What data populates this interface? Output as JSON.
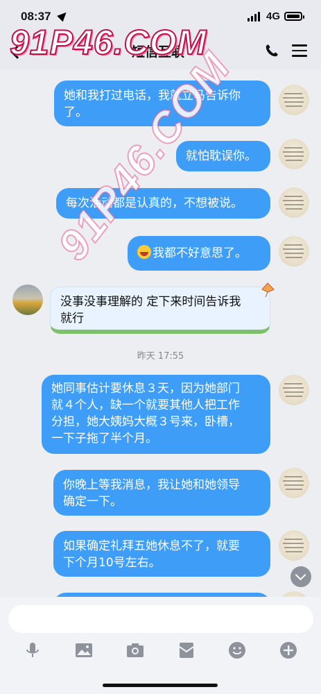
{
  "status_bar": {
    "time": "08:37",
    "network": "4G"
  },
  "header": {
    "title": "短信互联"
  },
  "watermark": {
    "top": "91P46.COM",
    "diagonal": "91P46.COM"
  },
  "messages": [
    {
      "side": "me",
      "lines": [
        "她和我打过电话，我就立马告诉你",
        "了。"
      ]
    },
    {
      "side": "me",
      "lines": [
        "就怕耽误你。"
      ]
    },
    {
      "side": "me",
      "lines": [
        "每次活动都是认真的，不想被说。"
      ]
    },
    {
      "side": "me",
      "emoji": "laughing-emoji",
      "lines": [
        "我都不好意思了。"
      ]
    },
    {
      "side": "other",
      "lines": [
        "没事没事理解的 定下来时间告诉我",
        "就行"
      ]
    },
    {
      "side": "me",
      "lines": [
        "她同事估计要休息３天，因为她部门",
        "就４个人，缺一个就要其他人把工作",
        "分担，她大姨妈大概３号来，卧槽，",
        "一下子拖了半个月。"
      ]
    },
    {
      "side": "me",
      "lines": [
        "你晚上等我消息，我让她和她领导",
        "确定一下。"
      ]
    },
    {
      "side": "me",
      "lines": [
        "如果确定礼拜五她休息不了，就要",
        "下个月10号左右。"
      ]
    }
  ],
  "timestamp": "昨天 17:55",
  "input": {
    "placeholder": ""
  },
  "toolbar": [
    "mic-icon",
    "image-icon",
    "camera-icon",
    "red-packet-icon",
    "emoji-icon",
    "plus-icon"
  ],
  "colors": {
    "bubble_me": "#3e9df6",
    "bubble_other": "#e9f3ff",
    "watermark": "#c0124a"
  }
}
